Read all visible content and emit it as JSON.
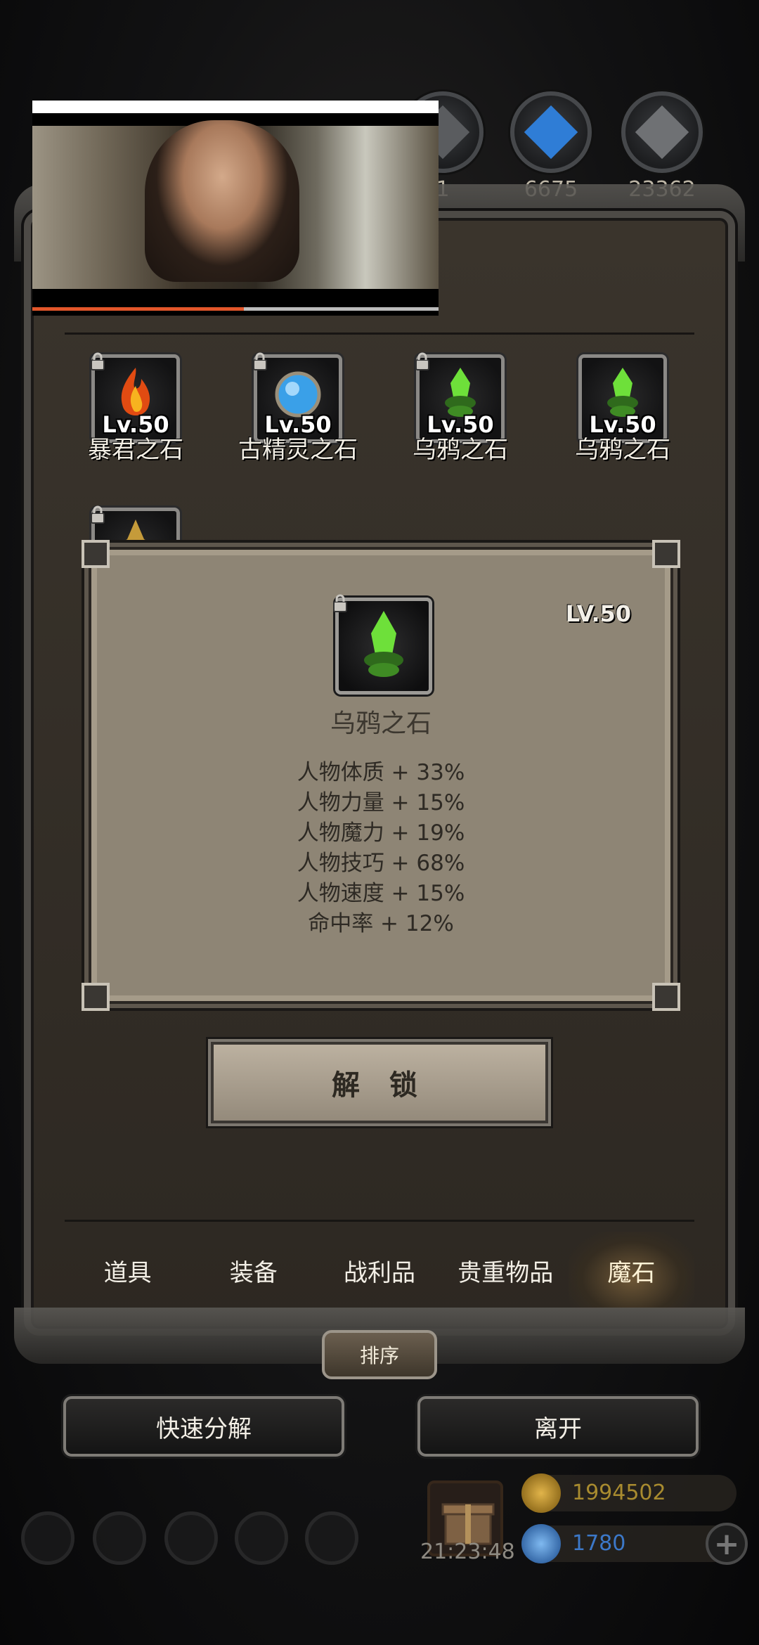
{
  "top_resources": [
    {
      "name": "dark-ore",
      "count": "1",
      "color": "#6d6f72"
    },
    {
      "name": "blue-crystal",
      "count": "6675",
      "color": "#2f7dd6"
    },
    {
      "name": "grey-ore",
      "count": "23362",
      "color": "#6f7174"
    }
  ],
  "video_overlay": {
    "progress": 0.52
  },
  "stones": [
    {
      "level": "Lv.50",
      "name": "暴君之石",
      "icon": "fire-stone-icon"
    },
    {
      "level": "Lv.50",
      "name": "古精灵之石",
      "icon": "blue-orb-stone-icon"
    },
    {
      "level": "Lv.50",
      "name": "乌鸦之石",
      "icon": "green-crystal-stone-icon"
    },
    {
      "level": "Lv.50",
      "name": "乌鸦之石",
      "icon": "green-crystal-stone-icon"
    },
    {
      "level": "",
      "name": "",
      "icon": "gold-wing-stone-icon"
    }
  ],
  "detail": {
    "level": "LV.50",
    "name": "乌鸦之石",
    "stats": [
      "人物体质 + 33%",
      "人物力量 + 15%",
      "人物魔力 + 19%",
      "人物技巧 + 68%",
      "人物速度 + 15%",
      "命中率 + 12%"
    ]
  },
  "unlock_label": "解 锁",
  "tabs": [
    "道具",
    "装备",
    "战利品",
    "贵重物品",
    "魔石"
  ],
  "active_tab_index": 4,
  "sort_label": "排序",
  "quick_decompose_label": "快速分解",
  "leave_label": "离开",
  "hud": {
    "time": "21:23:48",
    "gold": "1994502",
    "gems": "1780",
    "gold_color": "#a88b2f",
    "gem_color": "#3c78c8"
  }
}
